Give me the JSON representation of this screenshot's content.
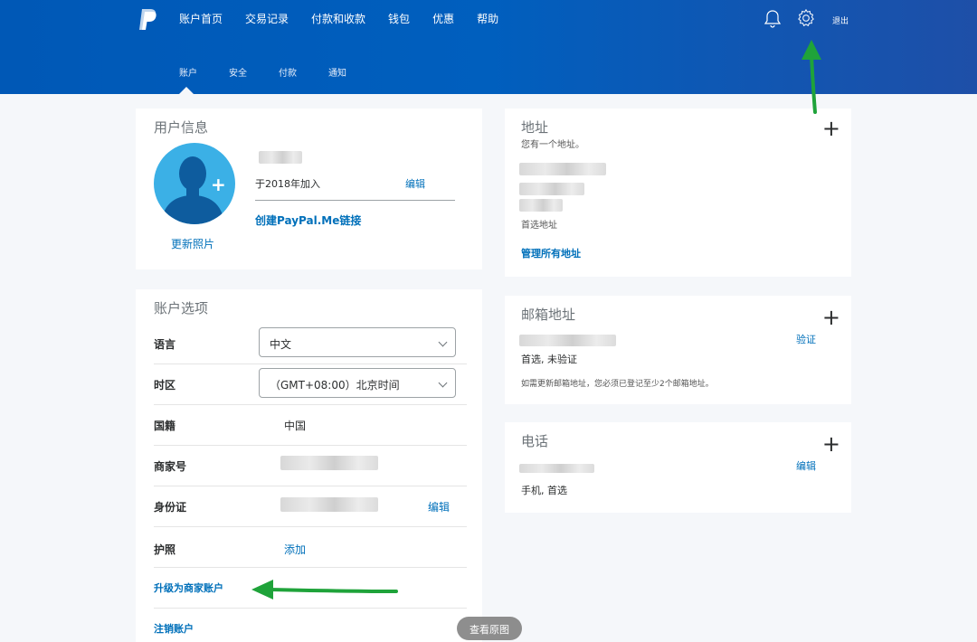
{
  "header": {
    "nav": [
      "账户首页",
      "交易记录",
      "付款和收款",
      "钱包",
      "优惠",
      "帮助"
    ],
    "subnav": [
      "账户",
      "安全",
      "付款",
      "通知"
    ],
    "logout": "退出"
  },
  "user_info": {
    "title": "用户信息",
    "joined": "于2018年加入",
    "edit": "编辑",
    "create_link": "创建PayPal.Me链接",
    "update_photo": "更新照片"
  },
  "account_options": {
    "title": "账户选项",
    "language_label": "语言",
    "language_value": "中文",
    "timezone_label": "时区",
    "timezone_value": "（GMT+08:00）北京时间",
    "nationality_label": "国籍",
    "nationality_value": "中国",
    "merchant_label": "商家号",
    "id_label": "身份证",
    "id_edit": "编辑",
    "passport_label": "护照",
    "passport_add": "添加",
    "upgrade": "升级为商家账户",
    "close_account": "注销账户"
  },
  "address": {
    "title": "地址",
    "subtitle": "您有一个地址。",
    "primary": "首选地址",
    "manage": "管理所有地址"
  },
  "email": {
    "title": "邮箱地址",
    "verify": "验证",
    "status": "首选, 未验证",
    "note": "如需更新邮箱地址，您必须已登记至少2个邮箱地址。"
  },
  "phone": {
    "title": "电话",
    "edit": "编辑",
    "status": "手机, 首选"
  },
  "view_source": "查看原图",
  "colors": {
    "brand": "#0070ba",
    "header": "#005fbe",
    "arrow": "#1fa33a"
  }
}
